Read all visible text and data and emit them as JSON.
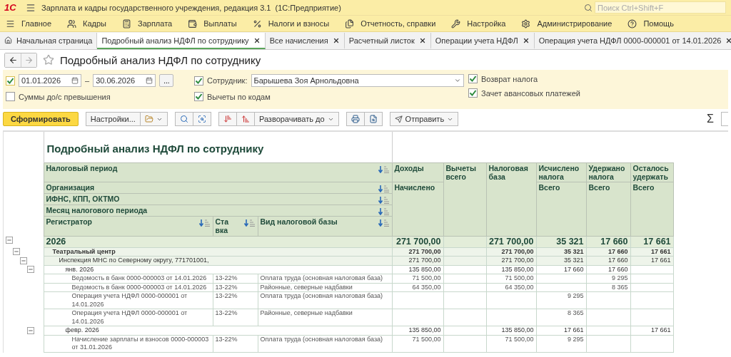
{
  "window": {
    "logo": "1С",
    "title": "Зарплата и кадры государственного учреждения, редакция 3.1  (1С:Предприятие)",
    "search": {
      "placeholder": "Поиск Ctrl+Shift+F"
    }
  },
  "menu": [
    {
      "label": "Главное",
      "kind": "main"
    },
    {
      "label": "Кадры",
      "kind": "staff"
    },
    {
      "label": "Зарплата",
      "kind": "salary"
    },
    {
      "label": "Выплаты",
      "kind": "payments"
    },
    {
      "label": "Налоги и взносы",
      "kind": "taxes"
    },
    {
      "label": "Отчетность, справки",
      "kind": "reports"
    },
    {
      "label": "Настройка",
      "kind": "setup"
    },
    {
      "label": "Администрирование",
      "kind": "admin"
    },
    {
      "label": "Помощь",
      "kind": "help"
    }
  ],
  "tabs": [
    {
      "label": "Начальная страница",
      "kind": "home",
      "selected": false
    },
    {
      "label": "Подробный анализ НДФЛ по сотруднику",
      "kind": "doc",
      "selected": true
    },
    {
      "label": "Все начисления",
      "kind": "doc",
      "selected": false
    },
    {
      "label": "Расчетный листок",
      "kind": "doc",
      "selected": false
    },
    {
      "label": "Операции учета НДФЛ",
      "kind": "doc",
      "selected": false
    },
    {
      "label": "Операция учета НДФЛ 0000-000001 от 14.01.2026",
      "kind": "doc",
      "selected": false
    }
  ],
  "form": {
    "title": "Подробный анализ НДФЛ по сотруднику",
    "period": {
      "checked": true,
      "from": "01.01.2026",
      "dash": "–",
      "to": "30.06.2026",
      "more": "..."
    },
    "amounts_option": {
      "label": "Суммы до/с превышения",
      "checked": false
    },
    "employee": {
      "label": "Сотрудник:",
      "checked": true,
      "value": "Барышева Зоя Арнольдовна"
    },
    "deductions_option": {
      "label": "Вычеты по кодам",
      "checked": true
    },
    "right_options": [
      {
        "label": "Возврат налога",
        "checked": true
      },
      {
        "label": "Зачет авансовых платежей",
        "checked": true
      }
    ]
  },
  "toolbar": {
    "generate": "Сформировать",
    "settings": "Настройки...",
    "expand": "Разворачивать до",
    "send": "Отправить",
    "sum": "Σ"
  },
  "report": {
    "title": "Подробный анализ НДФЛ по сотруднику",
    "groupings": [
      "Налоговый период",
      "Организация",
      "ИФНС, КПП, ОКТМО",
      "Месяц налогового периода"
    ],
    "registrar": "Регистратор",
    "rate": "Ставка",
    "base_type": "Вид налоговой базы",
    "columns": [
      {
        "top": "Доходы",
        "sub": "Начислено"
      },
      {
        "top": "Вычеты всего"
      },
      {
        "top": "Налоговая база"
      },
      {
        "top": "Исчислено налога",
        "sub": "Всего"
      },
      {
        "top": "Удержано налога",
        "sub": "Всего"
      },
      {
        "top": "Осталось удержать",
        "sub": "Всего"
      }
    ],
    "rows": [
      {
        "kind": "year",
        "label": "2026",
        "expanded": true,
        "income": "271 700,00",
        "base": "271 700,00",
        "calculated": "35 321",
        "withheld": "17 660",
        "remaining": "17 661",
        "children": [
          {
            "kind": "org",
            "label": "Театральный центр",
            "expanded": true,
            "income": "271 700,00",
            "base": "271 700,00",
            "calculated": "35 321",
            "withheld": "17 660",
            "remaining": "17 661",
            "children": [
              {
                "kind": "ifns",
                "label": "Инспекция МНС по Северному округу, 771701001,",
                "expanded": true,
                "income": "271 700,00",
                "base": "271 700,00",
                "calculated": "35 321",
                "withheld": "17 660",
                "remaining": "17 661",
                "children": [
                  {
                    "kind": "month",
                    "label": "янв. 2026",
                    "expanded": true,
                    "income": "135 850,00",
                    "base": "135 850,00",
                    "calculated": "17 660",
                    "withheld": "17 660",
                    "children": [
                      {
                        "kind": "doc",
                        "label": "Ведомость в банк 0000-000003 от 14.01.2026",
                        "rate": "13-22%",
                        "base_type": "Оплата труда (основная налоговая база)",
                        "income": "71 500,00",
                        "base": "71 500,00",
                        "withheld": "9 295"
                      },
                      {
                        "kind": "doc",
                        "label": "Ведомость в банк 0000-000003 от 14.01.2026",
                        "rate": "13-22%",
                        "base_type": "Районные, северные надбавки",
                        "income": "64 350,00",
                        "base": "64 350,00",
                        "withheld": "8 365"
                      },
                      {
                        "kind": "doc",
                        "label": "Операция учета НДФЛ 0000-000001 от 14.01.2026",
                        "rate": "13-22%",
                        "base_type": "Оплата труда (основная налоговая база)",
                        "calculated": "9 295"
                      },
                      {
                        "kind": "doc",
                        "label": "Операция учета НДФЛ 0000-000001 от 14.01.2026",
                        "rate": "13-22%",
                        "base_type": "Районные, северные надбавки",
                        "calculated": "8 365"
                      }
                    ]
                  },
                  {
                    "kind": "month",
                    "label": "февр. 2026",
                    "expanded": true,
                    "income": "135 850,00",
                    "base": "135 850,00",
                    "calculated": "17 661",
                    "remaining": "17 661",
                    "children": [
                      {
                        "kind": "doc",
                        "label": "Начисление зарплаты и взносов 0000-000003 от 31.01.2026",
                        "rate": "13-22%",
                        "base_type": "Оплата труда (основная налоговая база)",
                        "income": "71 500,00",
                        "base": "71 500,00",
                        "calculated": "9 295"
                      }
                    ]
                  }
                ]
              }
            ]
          }
        ]
      }
    ]
  }
}
